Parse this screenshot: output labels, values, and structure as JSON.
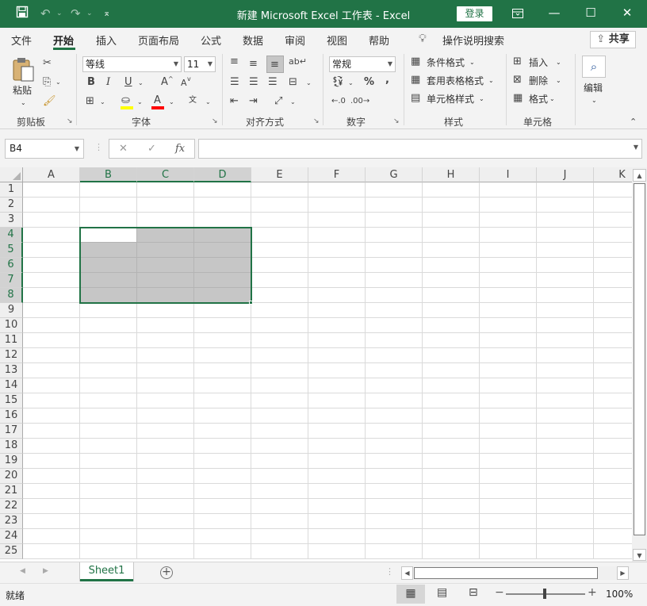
{
  "titlebar": {
    "title": "新建 Microsoft Excel 工作表  -  Excel",
    "login": "登录",
    "icons": [
      "save-icon",
      "undo-icon",
      "redo-icon",
      "customize-qat-icon",
      "ribbon-display-icon",
      "minimize-icon",
      "maximize-icon",
      "close-icon"
    ]
  },
  "tabs": {
    "file": "文件",
    "home": "开始",
    "insert": "插入",
    "layout": "页面布局",
    "formulas": "公式",
    "data": "数据",
    "review": "审阅",
    "view": "视图",
    "help": "帮助",
    "tellme": "操作说明搜索",
    "share": "共享"
  },
  "ribbon": {
    "clipboard": {
      "paste": "粘贴",
      "label": "剪贴板"
    },
    "font": {
      "name": "等线",
      "size": "11",
      "bold": "B",
      "italic": "I",
      "underline": "U",
      "grow": "A",
      "shrink": "A",
      "label": "字体",
      "fill_color": "#ffff00",
      "font_color": "#ff0000"
    },
    "alignment": {
      "label": "对齐方式"
    },
    "number": {
      "format": "常规",
      "percent": "%",
      "comma": ",",
      "label": "数字"
    },
    "styles": {
      "conditional": "条件格式",
      "table": "套用表格格式",
      "cellstyles": "单元格样式",
      "label": "样式"
    },
    "cells": {
      "insert": "插入",
      "delete": "删除",
      "format": "格式",
      "label": "单元格"
    },
    "editing": {
      "label": "编辑"
    }
  },
  "formula": {
    "namebox": "B4",
    "cancel": "✕",
    "enter": "✓",
    "fx": "fx",
    "value": ""
  },
  "grid": {
    "columns": [
      "A",
      "B",
      "C",
      "D",
      "E",
      "F",
      "G",
      "H",
      "I",
      "J",
      "K"
    ],
    "rows": [
      "1",
      "2",
      "3",
      "4",
      "5",
      "6",
      "7",
      "8",
      "9",
      "10",
      "11",
      "12",
      "13",
      "14",
      "15",
      "16",
      "17",
      "18",
      "19",
      "20",
      "21",
      "22",
      "23",
      "24",
      "25"
    ],
    "selected_columns": [
      "B",
      "C",
      "D"
    ],
    "selected_rows": [
      "4",
      "5",
      "6",
      "7",
      "8"
    ],
    "active_cell": "B4",
    "selection_range": "B4:D8"
  },
  "sheets": {
    "tabs": [
      "Sheet1"
    ],
    "active": "Sheet1"
  },
  "status": {
    "ready": "就绪",
    "zoom": "100%",
    "minus": "−",
    "plus": "+"
  },
  "colors": {
    "accent": "#217346",
    "selection_fill": "#c6c6c6"
  }
}
